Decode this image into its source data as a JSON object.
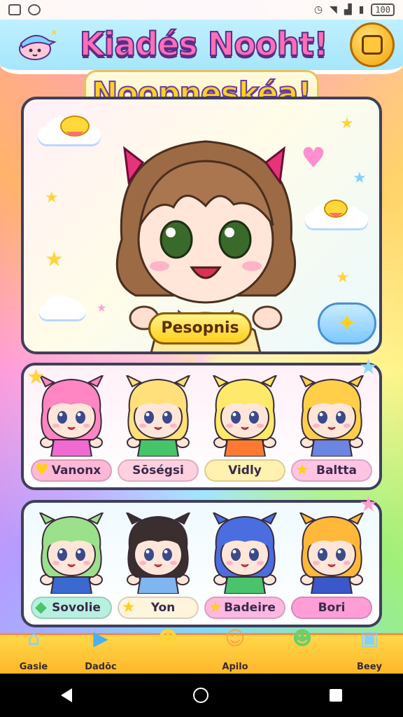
{
  "status_bar": {
    "battery": "100"
  },
  "header": {
    "title": "Kiadés Nooht!",
    "subtitle": "Noopneskéa!"
  },
  "hero": {
    "button_label": "Pesopnis"
  },
  "roster_row_1": [
    {
      "name": "Vanonx",
      "tag_color": "#ffb8d6",
      "hair": "#ff86c2",
      "outfit": "#f06ad0",
      "icon": "heart-icon"
    },
    {
      "name": "Sōségsi",
      "tag_color": "#ffd0e0",
      "hair": "#ffe07a",
      "outfit": "#46c46a",
      "icon": ""
    },
    {
      "name": "Vidly",
      "tag_color": "#fff1b0",
      "hair": "#ffe96a",
      "outfit": "#ff7a30",
      "icon": ""
    },
    {
      "name": "Baltta",
      "tag_color": "#ffc4e4",
      "hair": "#ffcf4a",
      "outfit": "#6a86e0",
      "icon": "star-icon"
    }
  ],
  "roster_row_2": [
    {
      "name": "Sovolie",
      "tag_color": "#b8f0e0",
      "hair": "#9be08a",
      "outfit": "#3a6ad0",
      "icon": "diamond-icon"
    },
    {
      "name": "Yon",
      "tag_color": "#fff4dc",
      "hair": "#3a2e2e",
      "outfit": "#7fb6f0",
      "icon": "star-icon"
    },
    {
      "name": "Badeire",
      "tag_color": "#ffb8e0",
      "hair": "#4a6ee0",
      "outfit": "#4ac46a",
      "icon": "star-icon"
    },
    {
      "name": "Bori",
      "tag_color": "#ff9ed6",
      "hair": "#ffb83a",
      "outfit": "#3a58c8",
      "icon": ""
    }
  ],
  "bottom_nav": [
    {
      "label": "Gasie",
      "icon": "house-icon"
    },
    {
      "label": "Dadōc",
      "icon": "play-icon"
    },
    {
      "label": "",
      "icon": "ice-cream-icon"
    },
    {
      "label": "Apilo",
      "icon": "mascot-icon"
    },
    {
      "label": "",
      "icon": "frog-icon"
    },
    {
      "label": "Beey",
      "icon": "gift-icon"
    }
  ]
}
